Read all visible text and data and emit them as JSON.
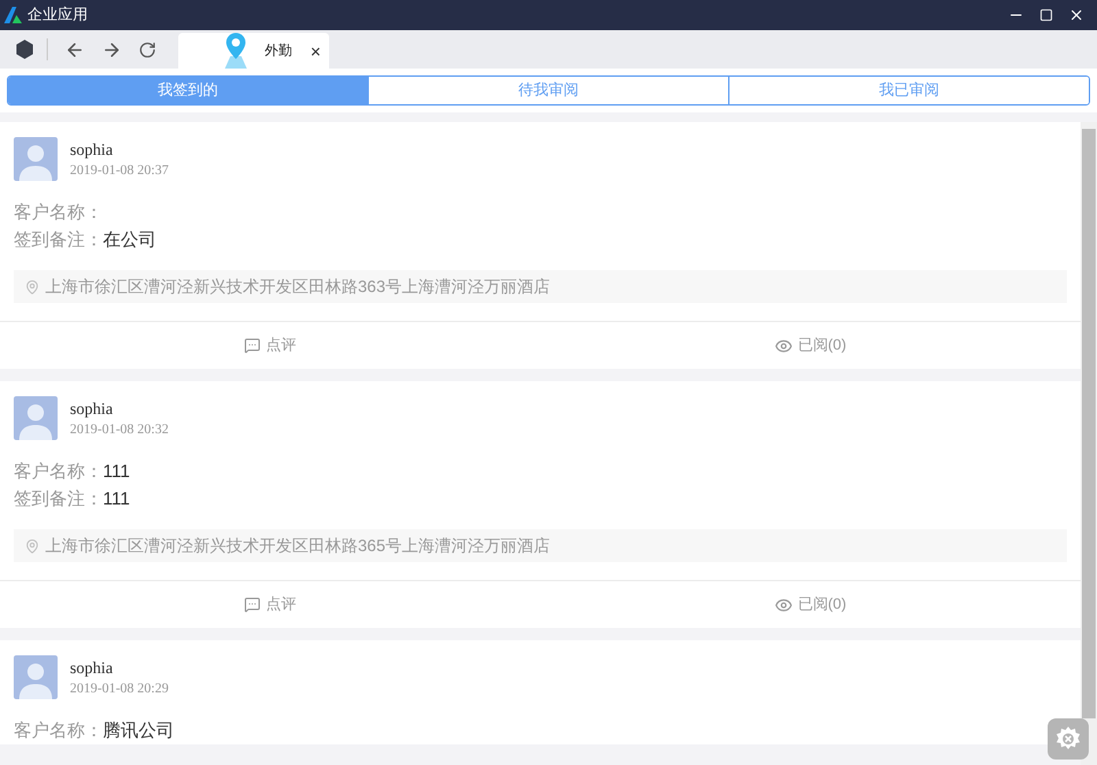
{
  "window": {
    "title": "企业应用"
  },
  "browser_tab": {
    "title": "外勤",
    "close": "×"
  },
  "segments": [
    {
      "label": "我签到的",
      "selected": true
    },
    {
      "label": "待我审阅",
      "selected": false
    },
    {
      "label": "我已审阅",
      "selected": false
    }
  ],
  "records": [
    {
      "name": "sophia",
      "time": "2019-01-08 20:37",
      "fields": [
        {
          "label": "客户名称："
        },
        {
          "label": "签到备注：",
          "value": "在公司"
        }
      ],
      "address": "上海市徐汇区漕河泾新兴技术开发区田林路363号上海漕河泾万丽酒店",
      "actions": [
        {
          "kind": "comment",
          "label": "点评"
        },
        {
          "kind": "read",
          "label": "已阅(0)"
        }
      ]
    },
    {
      "name": "sophia",
      "time": "2019-01-08 20:32",
      "fields": [
        {
          "label": "客户名称：",
          "value": "111"
        },
        {
          "label": "签到备注：",
          "value": "111"
        }
      ],
      "address": "上海市徐汇区漕河泾新兴技术开发区田林路365号上海漕河泾万丽酒店",
      "actions": [
        {
          "kind": "comment",
          "label": "点评"
        },
        {
          "kind": "read",
          "label": "已阅(0)"
        }
      ]
    },
    {
      "name": "sophia",
      "time": "2019-01-08 20:29",
      "fields": [
        {
          "label": "客户名称：",
          "value": "腾讯公司"
        }
      ]
    }
  ]
}
